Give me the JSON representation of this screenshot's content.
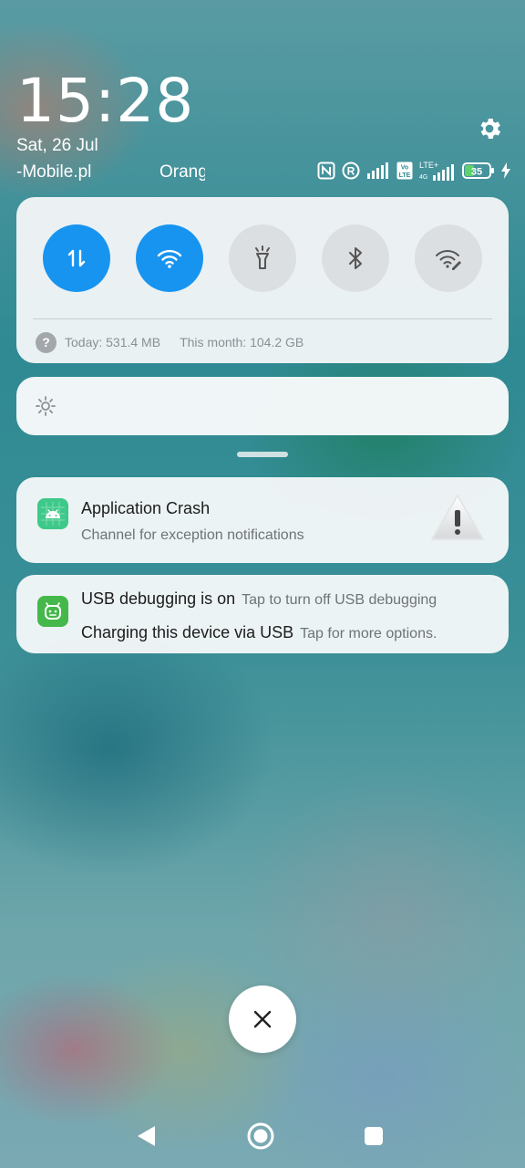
{
  "header": {
    "time": "15:28",
    "date": "Sat, 26 Jul",
    "carrier_1": "-Mobile.pl",
    "carrier_2": "Orange",
    "battery_level": "35",
    "settings_icon": "gear-icon"
  },
  "quick_settings": {
    "toggles": [
      {
        "name": "mobile-data",
        "icon": "data-transfer-icon",
        "active": true
      },
      {
        "name": "wifi",
        "icon": "wifi-icon",
        "active": true
      },
      {
        "name": "flashlight",
        "icon": "flashlight-icon",
        "active": false
      },
      {
        "name": "bluetooth",
        "icon": "bluetooth-icon",
        "active": false
      },
      {
        "name": "wifi-hotspot",
        "icon": "wifi-edit-icon",
        "active": false
      }
    ],
    "usage_today": "Today: 531.4 MB",
    "usage_month": "This month: 104.2 GB"
  },
  "brightness": {
    "icon": "sun-icon"
  },
  "notifications": [
    {
      "app_icon": "android-icon",
      "title": "Application Crash",
      "subtitle": "Channel for exception notifications",
      "image": "warning-triangle-icon"
    },
    {
      "app_icon": "android-debug-icon",
      "line1_title": "USB debugging is on",
      "line1_text": "Tap to turn off USB debugging",
      "line2_title": "Charging this device via USB",
      "line2_text": "Tap for more options."
    }
  ],
  "colors": {
    "accent": "#1794f0",
    "toggle_off": "#dcdfe2",
    "card_bg": "#f4f7f8"
  }
}
